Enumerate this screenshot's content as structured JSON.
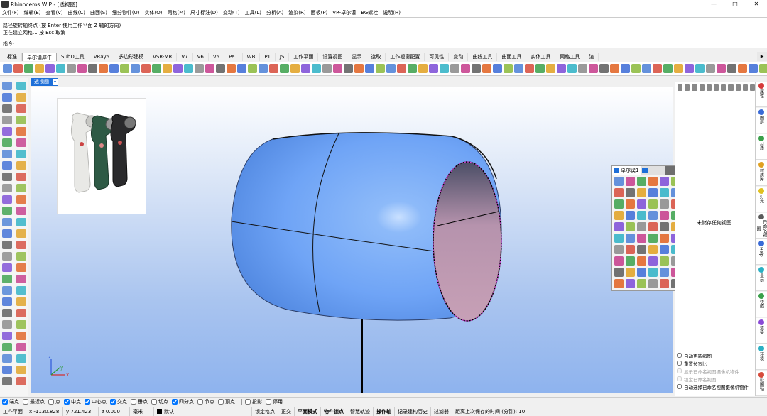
{
  "window": {
    "title": "Rhinoceros WIP - [透视图]",
    "controls": [
      "—",
      "□",
      "✕"
    ]
  },
  "menu": [
    "文件(F)",
    "编辑(E)",
    "查看(V)",
    "曲线(C)",
    "曲面(S)",
    "细分物件(U)",
    "实体(O)",
    "网格(M)",
    "尺寸标注(D)",
    "变动(T)",
    "工具(L)",
    "分析(A)",
    "渲染(R)",
    "面板(P)",
    "VR-卓尔谟",
    "BG螺栓",
    "说明(H)"
  ],
  "command": {
    "history": [
      "路径旋转轴终点 (按 Enter 使用工作平面 Z 轴的方向)",
      "正在建立网格... 按 Esc 取消"
    ],
    "prompt_label": "指令:",
    "value": ""
  },
  "tabs": [
    "标准",
    "卓尔谟犀牛",
    "SubD工具",
    "VRay5",
    "多边形建模",
    "VSR-MR",
    "V7",
    "V6",
    "V5",
    "PeT",
    "WB",
    "PT",
    "JS",
    "工作平面",
    "设置视图",
    "显示",
    "选取",
    "工作视窗配置",
    "可见性",
    "变动",
    "曲线工具",
    "曲面工具",
    "实体工具",
    "网格工具",
    "渲"
  ],
  "active_tab_index": 1,
  "viewport": {
    "label": "透视图",
    "axis_labels": [
      "z",
      "y",
      "x"
    ]
  },
  "float_panel": {
    "tab_label": "卓尔谟1"
  },
  "right_panel": {
    "empty_message": "未储存任何视图",
    "options": [
      {
        "label": "自动更新缩图",
        "checked": false,
        "disabled": false
      },
      {
        "label": "重置长宽比",
        "checked": false,
        "disabled": false
      },
      {
        "label": "显示已命名视图摄像机物件",
        "checked": false,
        "disabled": true
      },
      {
        "label": "锁定已命名视图",
        "checked": false,
        "disabled": true
      },
      {
        "label": "自动选择已命名视图摄像机物件",
        "checked": false,
        "disabled": false
      }
    ]
  },
  "side_tabs": [
    "属性",
    "图层",
    "材质",
    "材质库",
    "灯光",
    "已命名视图",
    "Help",
    "显示",
    "快照",
    "渲染",
    "环境",
    "贴图轴"
  ],
  "osnap": [
    {
      "label": "端点",
      "checked": true
    },
    {
      "label": "最近点",
      "checked": false
    },
    {
      "label": "点",
      "checked": false
    },
    {
      "label": "中点",
      "checked": true
    },
    {
      "label": "中心点",
      "checked": true
    },
    {
      "label": "交点",
      "checked": true
    },
    {
      "label": "垂点",
      "checked": false
    },
    {
      "label": "切点",
      "checked": false
    },
    {
      "label": "四分点",
      "checked": true
    },
    {
      "label": "节点",
      "checked": false
    },
    {
      "label": "顶点",
      "checked": false
    },
    {
      "label": "投影",
      "checked": false
    },
    {
      "label": "停用",
      "checked": false
    }
  ],
  "status": {
    "cplane": "工作平面",
    "x": "x -1130.828",
    "y": "y 721.423",
    "z": "z 0.000",
    "unit": "毫米",
    "layer": "默认",
    "toggles": [
      "锁定格点",
      "正交",
      "平面模式",
      "物件锁点",
      "智慧轨迹",
      "操作轴",
      "记录建构历史",
      "过滤器"
    ],
    "bold_toggles": [
      "平面模式",
      "物件锁点",
      "操作轴"
    ],
    "save_message": "距离上次保存的时间 (分钟): 10"
  },
  "colors": {
    "accent": "#1e6fd8",
    "model_body": "#6fa4f6",
    "model_inner": "#c49cb4"
  }
}
